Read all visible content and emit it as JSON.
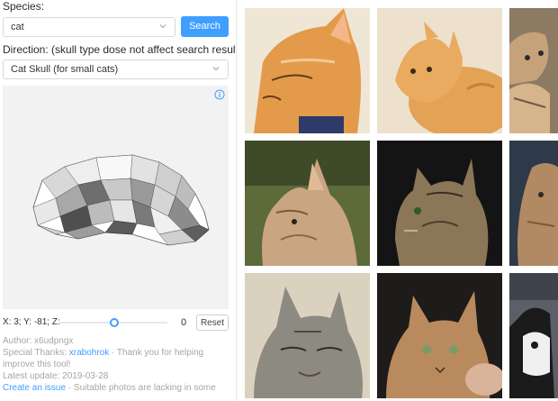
{
  "species": {
    "label": "Species:",
    "value": "cat",
    "search_button": "Search"
  },
  "direction": {
    "label": "Direction: (skull type dose not affect search results)",
    "value": "Cat Skull (for small cats)"
  },
  "viewer": {
    "info_icon": "info-icon"
  },
  "controls": {
    "coords": "X: 3; Y: -81; Z:",
    "z_value": "0",
    "reset_button": "Reset"
  },
  "meta": {
    "author": "Author: x6udpngx",
    "thanks_prefix": "Special Thanks:",
    "thanks_link": "xrabohrok",
    "thanks_suffix": "· Thank you for helping improve this tool!",
    "latest_update": "Latest update: 2019-03-28",
    "issue_link": "Create an issue",
    "issue_suffix": "· Suitable photos are lacking in some"
  },
  "colors": {
    "accent": "#409eff"
  },
  "images": [
    {
      "name": "cat-photo-1"
    },
    {
      "name": "cat-photo-2"
    },
    {
      "name": "cat-photo-3"
    },
    {
      "name": "cat-photo-4"
    },
    {
      "name": "cat-photo-5"
    },
    {
      "name": "cat-photo-6"
    },
    {
      "name": "cat-photo-7"
    },
    {
      "name": "cat-photo-8"
    },
    {
      "name": "cat-photo-9"
    }
  ]
}
